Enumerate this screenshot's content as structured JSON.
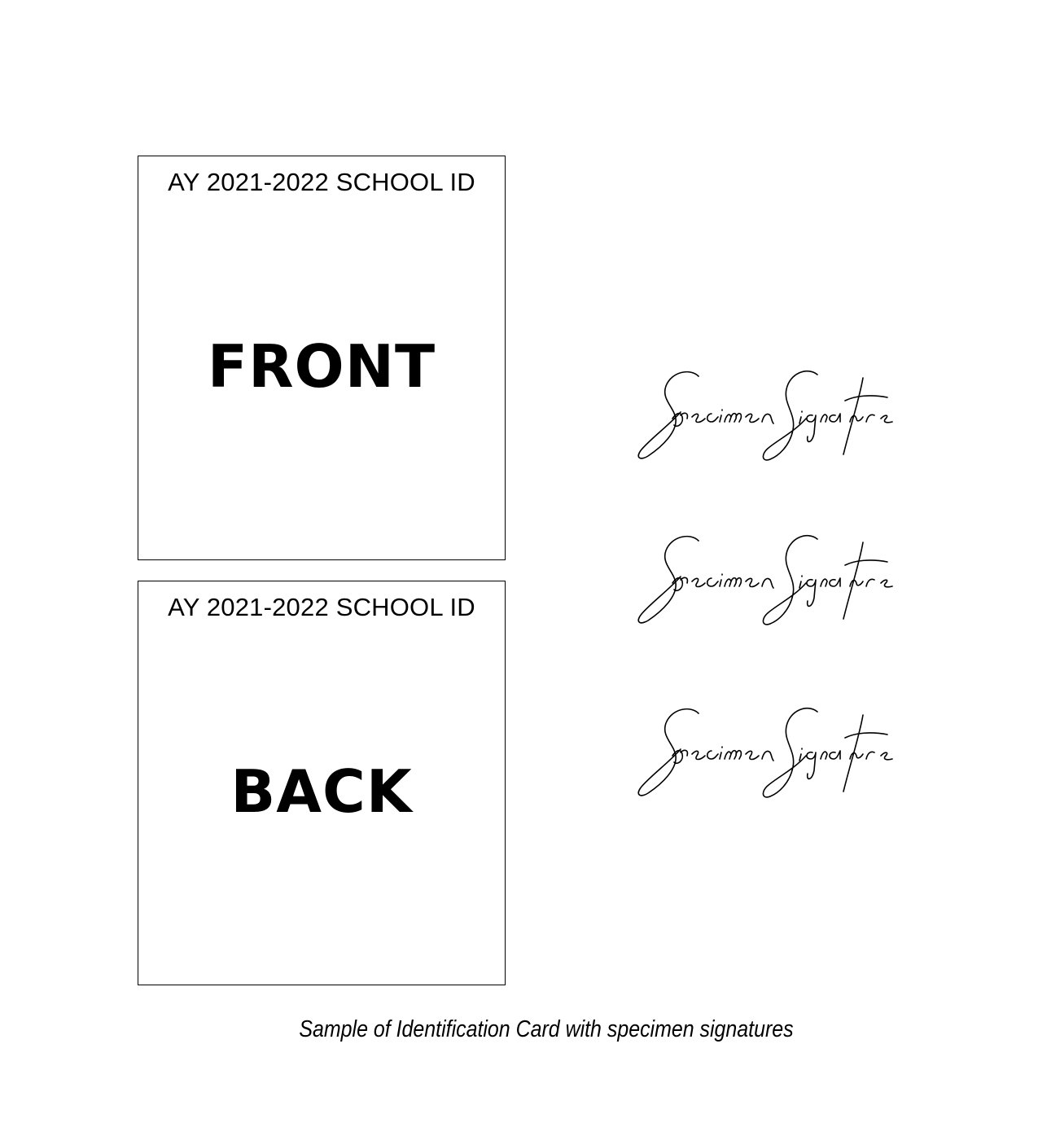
{
  "cards": {
    "front": {
      "header": "AY 2021-2022 SCHOOL ID",
      "side": "FRONT"
    },
    "back": {
      "header": "AY 2021-2022 SCHOOL ID",
      "side": "BACK"
    }
  },
  "signatures": [
    {
      "text": "Specimen Signature"
    },
    {
      "text": "Specimen Signature"
    },
    {
      "text": "Specimen Signature"
    }
  ],
  "caption": "Sample of Identification Card with specimen signatures"
}
